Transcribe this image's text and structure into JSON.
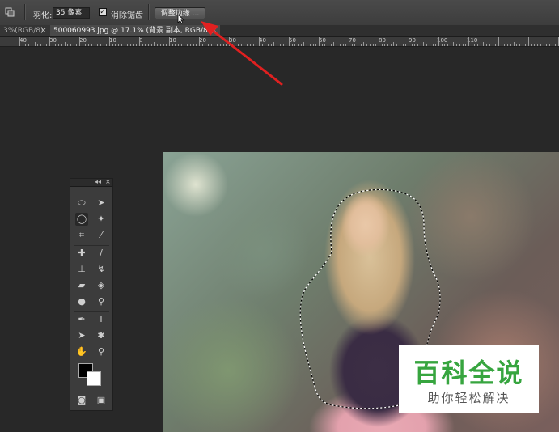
{
  "options_bar": {
    "feather_label": "羽化:",
    "feather_value": "35 像素",
    "anti_alias_label": "消除锯齿",
    "anti_alias_checked": true,
    "refine_edge_label": "调整边缘 ..."
  },
  "tabs": [
    {
      "label": "3%(RGB/8)",
      "close": "×"
    },
    {
      "label": "500060993.jpg @ 17.1% (背景 副本, RGB/8*)",
      "close": "×"
    }
  ],
  "ruler": {
    "numbers": [
      "40",
      "30",
      "20",
      "10",
      "0",
      "10",
      "20",
      "30",
      "40",
      "50",
      "60",
      "70",
      "80",
      "90",
      "100",
      "110"
    ]
  },
  "tools_panel": {
    "collapse_glyph": "◂◂",
    "close_glyph": "×",
    "foreground_color": "#000000",
    "background_color": "#ffffff"
  },
  "watermark": {
    "title": "百科全说",
    "subtitle": "助你轻松解决",
    "title_color": "#37a53f"
  },
  "colors": {
    "annotation_arrow": "#e02020",
    "workspace": "#282828"
  }
}
